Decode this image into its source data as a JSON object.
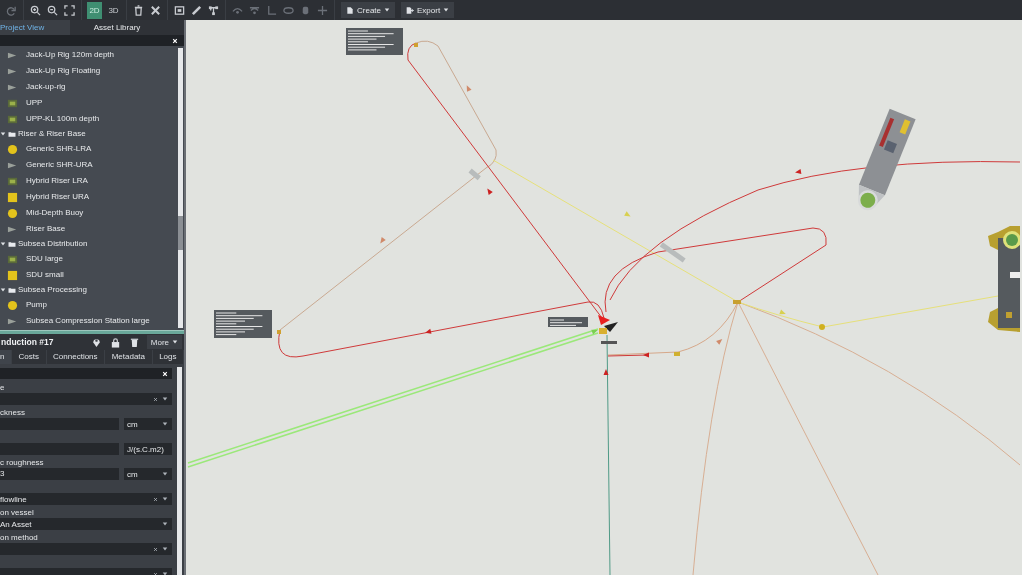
{
  "toolbar": {
    "view_modes": [
      {
        "label": "2D",
        "selected": true
      },
      {
        "label": "3D",
        "selected": false
      }
    ],
    "menus": [
      {
        "label": "Create"
      },
      {
        "label": "Export"
      }
    ]
  },
  "left_tabs": [
    {
      "label": "Project View",
      "selected": true
    },
    {
      "label": "Asset Library",
      "selected": false
    }
  ],
  "library": [
    {
      "kind": "asset",
      "label": "Jack-Up Rig 120m depth"
    },
    {
      "kind": "asset",
      "label": "Jack-Up Rig Floating"
    },
    {
      "kind": "asset",
      "label": "Jack-up-rig"
    },
    {
      "kind": "asset",
      "label": "UPP"
    },
    {
      "kind": "asset",
      "label": "UPP-KL 100m depth"
    },
    {
      "kind": "folder",
      "label": "Riser & Riser Base",
      "expanded": true,
      "children": [
        {
          "kind": "asset",
          "label": "Generic SHR-LRA"
        },
        {
          "kind": "asset",
          "label": "Generic SHR-URA"
        },
        {
          "kind": "asset",
          "label": "Hybrid Riser LRA"
        },
        {
          "kind": "asset",
          "label": "Hybrid Riser URA"
        },
        {
          "kind": "asset",
          "label": "Mid-Depth Buoy"
        },
        {
          "kind": "asset",
          "label": "Riser Base"
        }
      ]
    },
    {
      "kind": "folder",
      "label": "Subsea Distribution",
      "expanded": true,
      "children": [
        {
          "kind": "asset",
          "label": "SDU large"
        },
        {
          "kind": "asset",
          "label": "SDU small"
        }
      ]
    },
    {
      "kind": "folder",
      "label": "Subsea Processing",
      "expanded": true,
      "children": [
        {
          "kind": "asset",
          "label": "Pump"
        },
        {
          "kind": "asset",
          "label": "Subsea Compression Station large"
        }
      ]
    }
  ],
  "properties": {
    "title": "nduction #17",
    "actions": [
      {
        "label": "More"
      }
    ],
    "tabs": [
      {
        "label": "n",
        "selected": true
      },
      {
        "label": "Costs",
        "selected": false
      },
      {
        "label": "Connections",
        "selected": false
      },
      {
        "label": "Metadata",
        "selected": false
      },
      {
        "label": "Logs",
        "selected": false
      }
    ],
    "fields": [
      {
        "kind": "select",
        "label": "e",
        "clearable": true
      },
      {
        "kind": "unit",
        "label": "ckness",
        "unit": "cm"
      },
      {
        "kind": "unit",
        "unit": "J/(s.C.m2)"
      },
      {
        "kind": "unit",
        "label": "c roughness",
        "value": "3",
        "unit": "cm"
      },
      {
        "kind": "select",
        "value": "flowline",
        "clearable": true
      },
      {
        "kind": "select",
        "label": "on vessel",
        "value": "An Asset",
        "clearable": false
      },
      {
        "kind": "select",
        "label": "on method",
        "clearable": true
      },
      {
        "kind": "select",
        "clearable": true
      }
    ]
  }
}
